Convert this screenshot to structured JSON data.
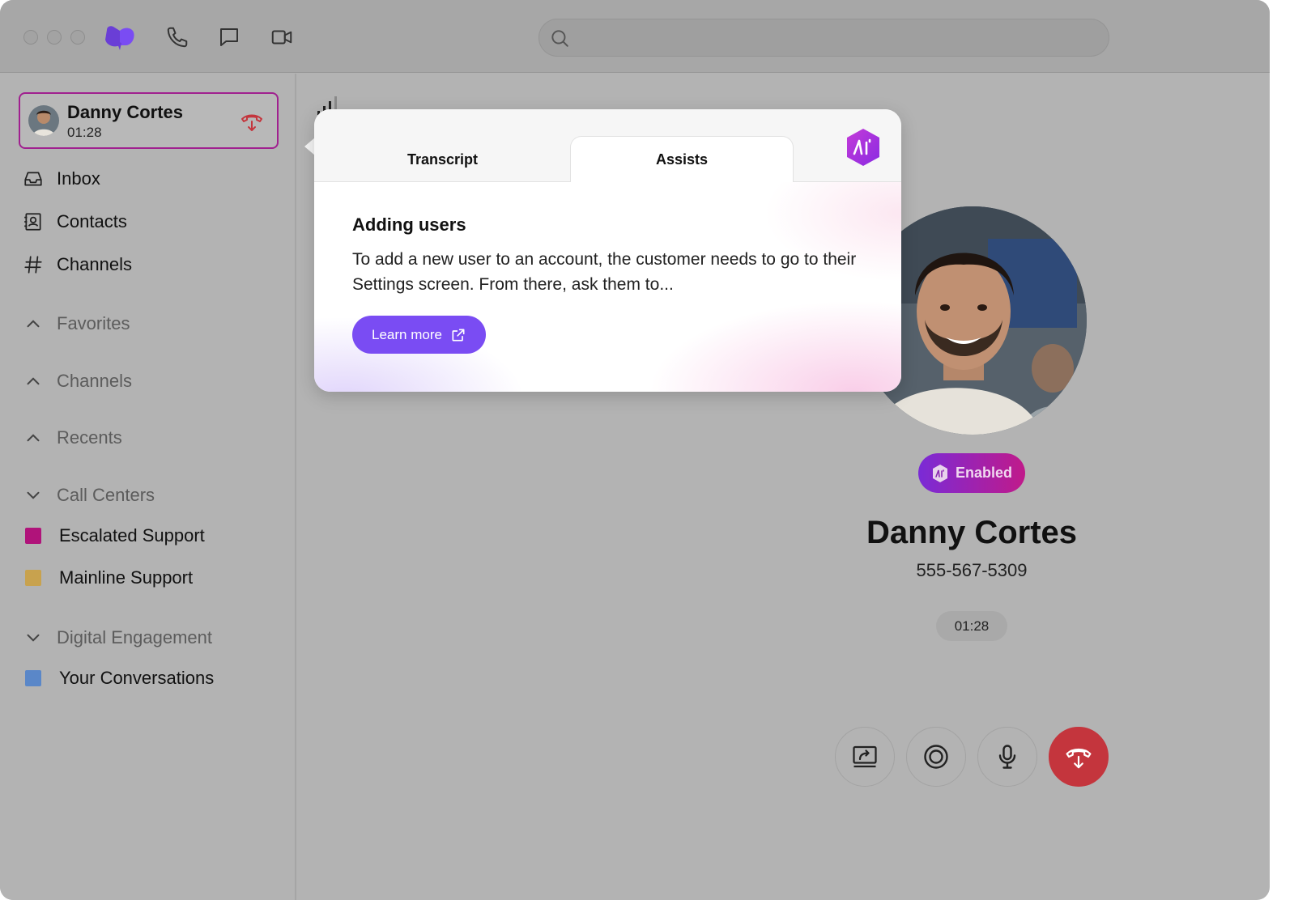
{
  "search": {
    "placeholder": ""
  },
  "active_call": {
    "name": "Danny Cortes",
    "duration": "01:28"
  },
  "nav": {
    "inbox": "Inbox",
    "contacts": "Contacts",
    "channels": "Channels"
  },
  "sections": {
    "favorites": "Favorites",
    "channels": "Channels",
    "recents": "Recents",
    "call_centers": "Call Centers",
    "digital_engagement": "Digital Engagement"
  },
  "call_centers": [
    {
      "label": "Escalated Support",
      "color": "#b0137a"
    },
    {
      "label": "Mainline Support",
      "color": "#c8a24e"
    }
  ],
  "digital_engagement": [
    {
      "label": "Your Conversations",
      "color": "#5a87c8"
    }
  ],
  "popover": {
    "tabs": {
      "transcript": "Transcript",
      "assists": "Assists"
    },
    "active_tab": "Assists",
    "title": "Adding users",
    "text": "To add a new user to an account, the customer needs to go to their Settings screen. From there, ask them to...",
    "button": "Learn more"
  },
  "caller": {
    "ai_status": "Enabled",
    "name": "Danny Cortes",
    "phone": "555-567-5309",
    "timer": "01:28"
  },
  "colors": {
    "accent": "#7a4cf3",
    "hangup": "#c4353d",
    "active_border": "#a0208f"
  }
}
